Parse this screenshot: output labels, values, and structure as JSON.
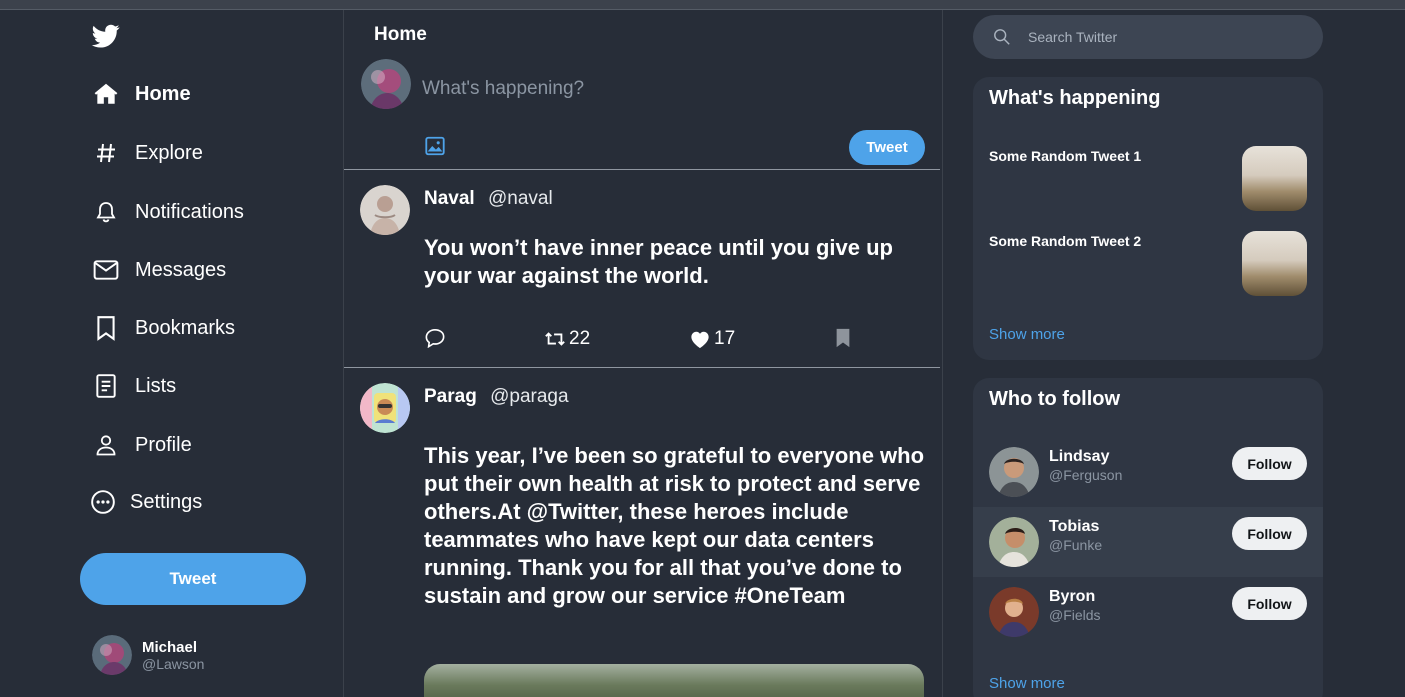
{
  "sidebar": {
    "logo": "twitter-bird-icon",
    "nav": [
      {
        "label": "Home",
        "icon": "home-icon",
        "active": true
      },
      {
        "label": "Explore",
        "icon": "hashtag-icon"
      },
      {
        "label": "Notifications",
        "icon": "bell-icon"
      },
      {
        "label": "Messages",
        "icon": "envelope-icon"
      },
      {
        "label": "Bookmarks",
        "icon": "bookmark-icon"
      },
      {
        "label": "Lists",
        "icon": "list-icon"
      },
      {
        "label": "Profile",
        "icon": "person-icon"
      },
      {
        "label": "Settings",
        "icon": "more-icon"
      }
    ],
    "tweet_button": "Tweet",
    "user": {
      "name": "Michael",
      "handle": "@Lawson"
    }
  },
  "feed": {
    "title": "Home",
    "compose": {
      "placeholder": "What's happening?",
      "button": "Tweet"
    },
    "posts": [
      {
        "name": "Naval",
        "handle": "@naval",
        "text": "You won’t have inner peace until you give up your war against the world.",
        "retweets": "22",
        "likes": "17"
      },
      {
        "name": "Parag",
        "handle": "@paraga",
        "text": "This year, I’ve been so grateful to everyone who put their own health at risk to protect and serve others.At @Twitter, these heroes include teammates who have kept our data centers running. Thank you for all that you’ve done to sustain and grow our service #OneTeam"
      }
    ]
  },
  "right": {
    "search_placeholder": "Search Twitter",
    "happening": {
      "title": "What's happening",
      "items": [
        {
          "text": "Some Random Tweet 1"
        },
        {
          "text": "Some Random Tweet 2"
        }
      ],
      "show_more": "Show more"
    },
    "who_to_follow": {
      "title": "Who to follow",
      "people": [
        {
          "name": "Lindsay",
          "handle": "@Ferguson",
          "button": "Follow"
        },
        {
          "name": "Tobias",
          "handle": "@Funke",
          "button": "Follow"
        },
        {
          "name": "Byron",
          "handle": "@Fields",
          "button": "Follow"
        }
      ],
      "show_more": "Show more"
    }
  },
  "colors": {
    "accent": "#4ea3e9",
    "background": "#272d38",
    "card": "#2f3643"
  }
}
